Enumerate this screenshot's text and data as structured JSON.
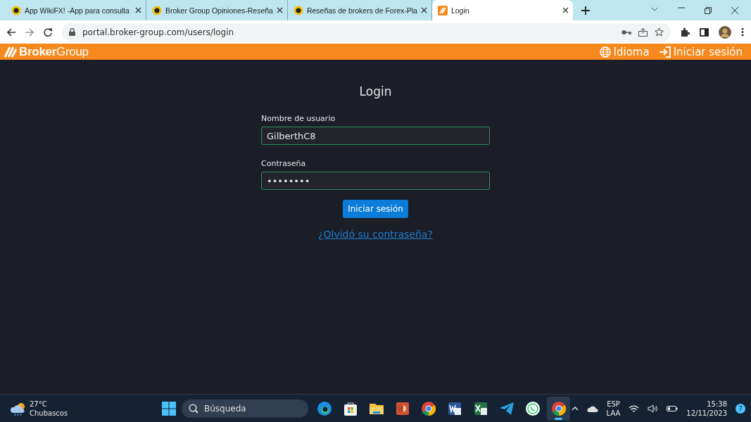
{
  "browser": {
    "tabs": [
      {
        "title": "App WikiFX! -App para consulta",
        "kind": "coin",
        "selected": false
      },
      {
        "title": "Broker Group Opiniones-Reseña",
        "kind": "coin",
        "selected": false
      },
      {
        "title": "Reseñas de brokers de Forex-Pla",
        "kind": "coin",
        "selected": false
      },
      {
        "title": "Login",
        "kind": "brand",
        "selected": true
      }
    ],
    "url": "portal.broker-group.com/users/login"
  },
  "header": {
    "logo": "**Broker**Group",
    "nav": [
      {
        "label": "Idioma",
        "kind": "globe"
      },
      {
        "label": "Iniciar sesión",
        "kind": "login"
      }
    ]
  },
  "login": {
    "title": "Login",
    "fields": [
      {
        "label": "Nombre de usuario",
        "value": "GilberthC8"
      },
      {
        "label": "Contraseña",
        "value": "••••••••"
      }
    ],
    "submit": "Iniciar sesión",
    "forgot": "¿Olvidó su contraseña?"
  },
  "taskbar": {
    "weather": {
      "temp": "27°C",
      "condition": "Chubascos"
    },
    "search": {
      "placeholder": "Búsqueda"
    },
    "apps": [
      {
        "kind": "edge",
        "selected": false
      },
      {
        "kind": "store",
        "selected": false
      },
      {
        "kind": "files",
        "selected": false
      },
      {
        "kind": "powerpoint",
        "selected": false
      },
      {
        "kind": "chrome",
        "selected": false
      },
      {
        "kind": "word",
        "selected": false
      },
      {
        "kind": "excel",
        "selected": false
      },
      {
        "kind": "telegram",
        "selected": false
      },
      {
        "kind": "whatsapp",
        "selected": false
      },
      {
        "kind": "chrome",
        "selected": true
      }
    ],
    "lang": [
      "ESP",
      "LAA"
    ],
    "time": "15:38",
    "date": "12/11/2023",
    "badge": "7"
  }
}
